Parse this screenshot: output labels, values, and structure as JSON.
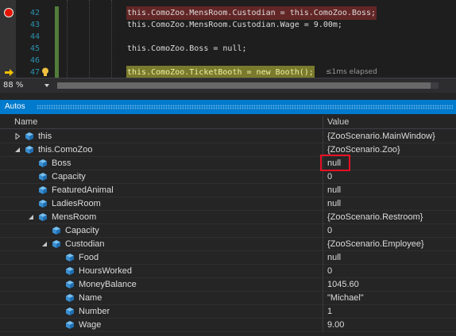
{
  "editor": {
    "lines": [
      {
        "number": "42",
        "code": "this.ComoZoo.MensRoom.Custodian = this.ComoZoo.Boss;",
        "style": "breakpoint"
      },
      {
        "number": "43",
        "code": "this.ComoZoo.MensRoom.Custodian.Wage = 9.00m;",
        "style": "normal"
      },
      {
        "number": "44",
        "code": "",
        "style": "normal"
      },
      {
        "number": "45",
        "code": "this.ComoZoo.Boss = null;",
        "style": "normal"
      },
      {
        "number": "46",
        "code": "",
        "style": "normal"
      },
      {
        "number": "47",
        "code": "this.ComoZoo.TicketBooth = new Booth();",
        "style": "current"
      }
    ],
    "elapsed": "≤1ms elapsed",
    "zoom": "88 %"
  },
  "autos": {
    "title": "Autos",
    "columns": {
      "name": "Name",
      "value": "Value"
    },
    "rows": [
      {
        "name": "this",
        "value": "{ZooScenario.MainWindow}",
        "level": 0,
        "expander": "collapsed",
        "icon": "object-icon"
      },
      {
        "name": "this.ComoZoo",
        "value": "{ZooScenario.Zoo}",
        "level": 0,
        "expander": "expanded",
        "icon": "object-icon"
      },
      {
        "name": "Boss",
        "value": "null",
        "level": 1,
        "expander": "none",
        "icon": "property-icon"
      },
      {
        "name": "Capacity",
        "value": "0",
        "level": 1,
        "expander": "none",
        "icon": "property-icon"
      },
      {
        "name": "FeaturedAnimal",
        "value": "null",
        "level": 1,
        "expander": "none",
        "icon": "property-icon"
      },
      {
        "name": "LadiesRoom",
        "value": "null",
        "level": 1,
        "expander": "none",
        "icon": "property-icon"
      },
      {
        "name": "MensRoom",
        "value": "{ZooScenario.Restroom}",
        "level": 1,
        "expander": "expanded",
        "icon": "property-icon"
      },
      {
        "name": "Capacity",
        "value": "0",
        "level": 2,
        "expander": "none",
        "icon": "property-icon"
      },
      {
        "name": "Custodian",
        "value": "{ZooScenario.Employee}",
        "level": 2,
        "expander": "expanded",
        "icon": "property-icon"
      },
      {
        "name": "Food",
        "value": "null",
        "level": 3,
        "expander": "none",
        "icon": "property-icon"
      },
      {
        "name": "HoursWorked",
        "value": "0",
        "level": 3,
        "expander": "none",
        "icon": "property-icon"
      },
      {
        "name": "MoneyBalance",
        "value": "1045.60",
        "level": 3,
        "expander": "none",
        "icon": "property-icon"
      },
      {
        "name": "Name",
        "value": "\"Michael\"",
        "level": 3,
        "expander": "none",
        "icon": "property-icon"
      },
      {
        "name": "Number",
        "value": "1",
        "level": 3,
        "expander": "none",
        "icon": "property-icon"
      },
      {
        "name": "Wage",
        "value": "9.00",
        "level": 3,
        "expander": "none",
        "icon": "property-icon"
      }
    ]
  },
  "colors": {
    "accent": "#007acc",
    "breakpoint": "#e51400",
    "highlight_box": "#e81123"
  }
}
